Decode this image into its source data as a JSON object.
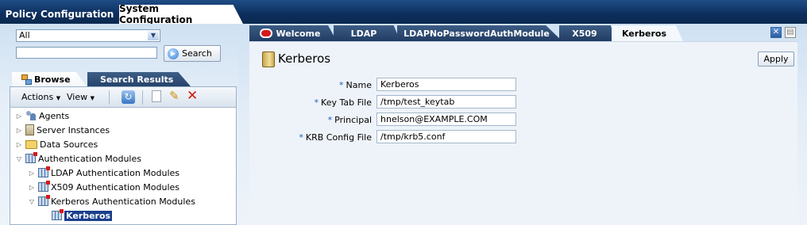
{
  "top_tabs": {
    "policy": "Policy Configuration",
    "system": "System Configuration"
  },
  "browse": {
    "select_value": "All",
    "search_value": "",
    "search_button": "Search",
    "tab_browse": "Browse",
    "tab_results": "Search Results",
    "actions_menu": "Actions",
    "view_menu": "View"
  },
  "tree": [
    {
      "label": "Agents",
      "icon": "people-icon",
      "expanded": false,
      "level": 0
    },
    {
      "label": "Server Instances",
      "icon": "server-icon",
      "expanded": false,
      "level": 0
    },
    {
      "label": "Data Sources",
      "icon": "folder-icon",
      "expanded": false,
      "level": 0
    },
    {
      "label": "Authentication Modules",
      "icon": "module-icon",
      "expanded": true,
      "level": 0
    },
    {
      "label": "LDAP Authentication Modules",
      "icon": "module-icon",
      "expanded": false,
      "level": 1
    },
    {
      "label": "X509 Authentication Modules",
      "icon": "module-icon",
      "expanded": false,
      "level": 1
    },
    {
      "label": "Kerberos Authentication Modules",
      "icon": "module-icon",
      "expanded": true,
      "level": 1
    },
    {
      "label": "Kerberos",
      "icon": "module-icon",
      "selected": true,
      "level": 2
    }
  ],
  "right_tabs": [
    "Welcome",
    "LDAP",
    "LDAPNoPasswordAuthModule",
    "X509",
    "Kerberos"
  ],
  "active_right_tab": "Kerberos",
  "page": {
    "title": "Kerberos",
    "apply_button": "Apply"
  },
  "form": [
    {
      "label": "Name",
      "value": "Kerberos",
      "required": "*"
    },
    {
      "label": "Key Tab File",
      "value": "/tmp/test_keytab",
      "required": "*"
    },
    {
      "label": "Principal",
      "value": "hnelson@EXAMPLE.COM",
      "required": "*"
    },
    {
      "label": "KRB Config File",
      "value": "/tmp/krb5.conf",
      "required": "*"
    }
  ]
}
